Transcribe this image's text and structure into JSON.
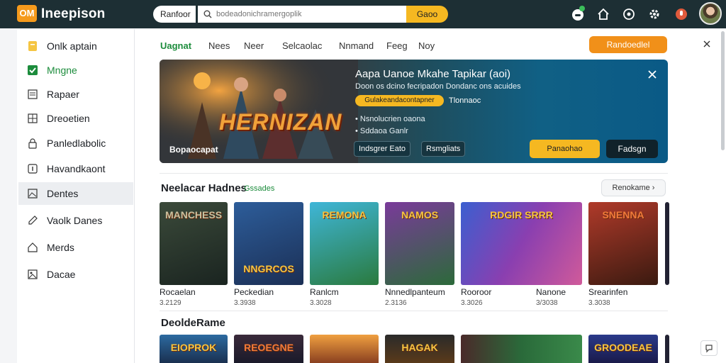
{
  "app": {
    "logo": "OM",
    "title": "Ineepison"
  },
  "search": {
    "filter": "Ranfoor",
    "placeholder": "bodeadonichramergoplik",
    "button": "Gaoo"
  },
  "top_icons": [
    "gamepad-icon",
    "home-icon",
    "headset-icon",
    "settings-icon",
    "notification-icon"
  ],
  "sidebar": {
    "items": [
      {
        "label": "Onlk aptain",
        "icon": "note-icon"
      },
      {
        "label": "Mngne",
        "icon": "checkbox-icon"
      },
      {
        "label": "Rapaer",
        "icon": "list-icon"
      },
      {
        "label": "Dreoetien",
        "icon": "grid-icon"
      },
      {
        "label": "Panledlabolic",
        "icon": "lock-icon"
      },
      {
        "label": "Havandkaont",
        "icon": "info-icon"
      },
      {
        "label": "Dentes",
        "icon": "image-icon"
      },
      {
        "label": "Vaolk Danes",
        "icon": "pen-icon"
      },
      {
        "label": "Merds",
        "icon": "house-icon"
      },
      {
        "label": "Dacae",
        "icon": "picture-icon"
      }
    ],
    "active_index": 6
  },
  "tabs": [
    "Uagnat",
    "Nees",
    "Neer",
    "Selcaolac",
    "Nnmand",
    "Feeg",
    "Noy"
  ],
  "cta": "Randoedlel",
  "banner": {
    "art_title": "HERNIZAN",
    "caption": "Bopaocapat",
    "title": "Aapa Uanoe Mkahe Tapikar (aoi)",
    "subtitle": "Doon os dcino fecripadon  Dondanc ons acuides",
    "pill": "Gulakeandacontapner",
    "pill_note": "Tlonnaoc",
    "bullets": [
      "Nsnolucrien oaona",
      "Sddaoa Ganlr"
    ],
    "chips": [
      "Indsgrer Eato",
      "Rsmgliats"
    ],
    "primary_button": "Panaohao",
    "secondary_button": "Fadsgn"
  },
  "section1": {
    "title": "Neelacar Hadnes",
    "tag": "Gssades",
    "see_more": "Renokame",
    "games": [
      {
        "thumb": "MANCHESS",
        "name": "Rocaelan",
        "meta": "3.2129"
      },
      {
        "thumb": "NNGRCOS",
        "name": "Peckedian",
        "meta": "3.3938"
      },
      {
        "thumb": "REMONA",
        "name": "Ranlcm",
        "meta": "3.3028"
      },
      {
        "thumb": "NAMOS",
        "name": "Nnnedlpanteum",
        "meta": "2.3136"
      },
      {
        "thumb": "RDGIR SRRR",
        "name": "Rooroor",
        "meta": "3.3026"
      },
      {
        "thumb": "",
        "name": "Nanone",
        "meta": "3/3038"
      },
      {
        "thumb": "SNENNA",
        "name": "Srearinfen",
        "meta": "3.3038"
      }
    ]
  },
  "section2": {
    "title": "DeoldeRame",
    "thumbs": [
      "EIOPROK",
      "REOEGNE",
      "",
      "HAGAK",
      "",
      "",
      "GROODEAE"
    ]
  },
  "colors": {
    "topbar": "#1d2f34",
    "accent_orange": "#f19019",
    "accent_yellow": "#f5b821",
    "active_green": "#1c8c3c"
  }
}
